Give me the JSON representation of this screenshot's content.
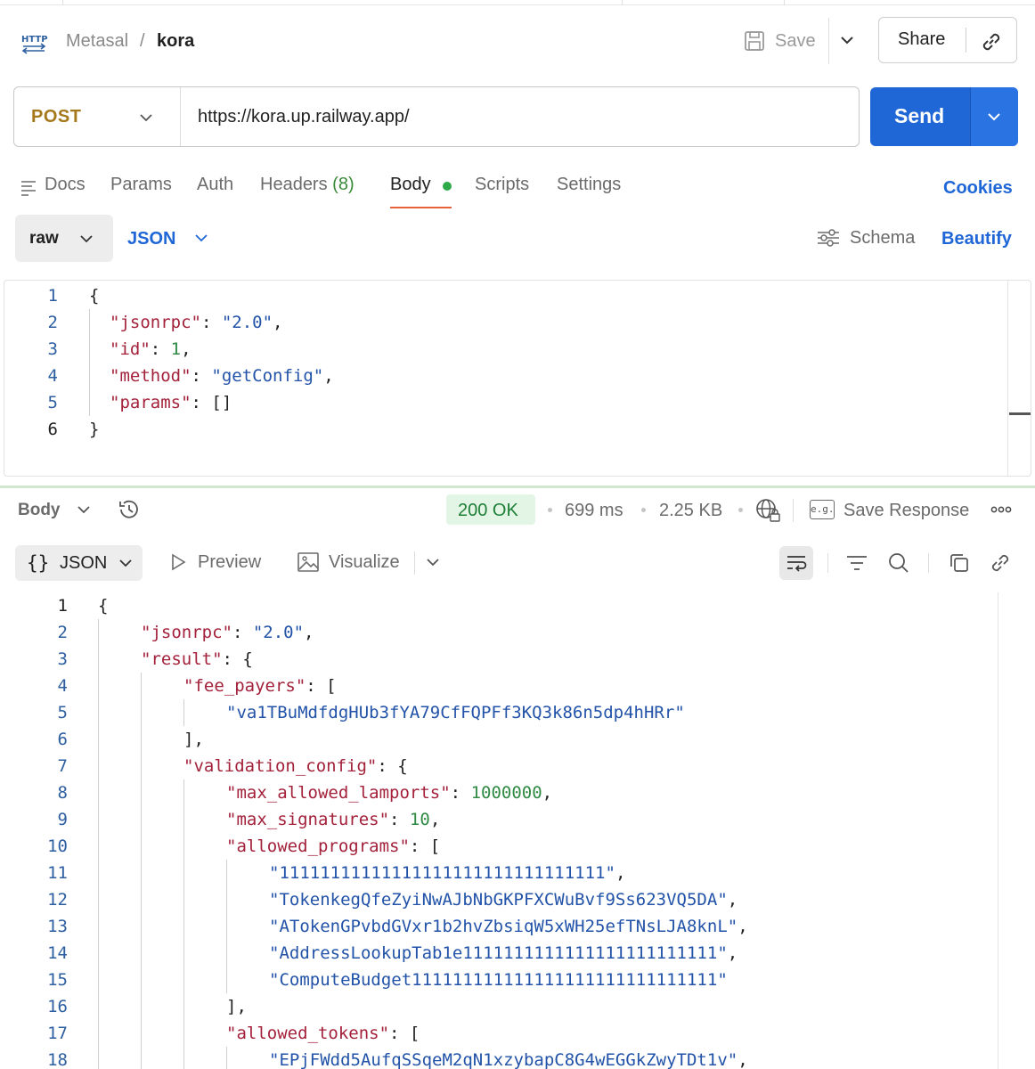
{
  "header": {
    "workspace": "Metasal",
    "separator": "/",
    "request_name": "kora",
    "save_label": "Save",
    "share_label": "Share"
  },
  "request": {
    "method": "POST",
    "url": "https://kora.up.railway.app/",
    "send_label": "Send"
  },
  "tabs": [
    {
      "label": "Docs"
    },
    {
      "label": "Params"
    },
    {
      "label": "Auth"
    },
    {
      "label": "Headers",
      "count": "(8)"
    },
    {
      "label": "Body",
      "active": true
    },
    {
      "label": "Scripts"
    },
    {
      "label": "Settings"
    }
  ],
  "cookies_label": "Cookies",
  "body_mode": {
    "raw_label": "raw",
    "format_label": "JSON",
    "schema_label": "Schema",
    "beautify_label": "Beautify"
  },
  "request_body_lines": [
    [
      [
        "p",
        "{"
      ]
    ],
    [
      [
        "k",
        "\"jsonrpc\""
      ],
      [
        "p",
        ": "
      ],
      [
        "s",
        "\"2.0\""
      ],
      [
        "p",
        ","
      ]
    ],
    [
      [
        "k",
        "\"id\""
      ],
      [
        "p",
        ": "
      ],
      [
        "n",
        "1"
      ],
      [
        "p",
        ","
      ]
    ],
    [
      [
        "k",
        "\"method\""
      ],
      [
        "p",
        ": "
      ],
      [
        "s",
        "\"getConfig\""
      ],
      [
        "p",
        ","
      ]
    ],
    [
      [
        "k",
        "\"params\""
      ],
      [
        "p",
        ": []"
      ]
    ],
    [
      [
        "p",
        "}"
      ]
    ]
  ],
  "request_body_indent": [
    0,
    1,
    1,
    1,
    1,
    0
  ],
  "response": {
    "body_label": "Body",
    "status": "200 OK",
    "time": "699 ms",
    "size": "2.25 KB",
    "save_response_label": "Save Response",
    "format_label": "JSON",
    "preview_label": "Preview",
    "visualize_label": "Visualize"
  },
  "response_body_lines": [
    [
      [
        "p",
        "{"
      ]
    ],
    [
      [
        "k",
        "\"jsonrpc\""
      ],
      [
        "p",
        ": "
      ],
      [
        "s",
        "\"2.0\""
      ],
      [
        "p",
        ","
      ]
    ],
    [
      [
        "k",
        "\"result\""
      ],
      [
        "p",
        ": {"
      ]
    ],
    [
      [
        "k",
        "\"fee_payers\""
      ],
      [
        "p",
        ": ["
      ]
    ],
    [
      [
        "s",
        "\"va1TBuMdfdgHUb3fYA79CfFQPFf3KQ3k86n5dp4hHRr\""
      ]
    ],
    [
      [
        "p",
        "],"
      ]
    ],
    [
      [
        "k",
        "\"validation_config\""
      ],
      [
        "p",
        ": {"
      ]
    ],
    [
      [
        "k",
        "\"max_allowed_lamports\""
      ],
      [
        "p",
        ": "
      ],
      [
        "n",
        "1000000"
      ],
      [
        "p",
        ","
      ]
    ],
    [
      [
        "k",
        "\"max_signatures\""
      ],
      [
        "p",
        ": "
      ],
      [
        "n",
        "10"
      ],
      [
        "p",
        ","
      ]
    ],
    [
      [
        "k",
        "\"allowed_programs\""
      ],
      [
        "p",
        ": ["
      ]
    ],
    [
      [
        "s",
        "\"11111111111111111111111111111111\""
      ],
      [
        "p",
        ","
      ]
    ],
    [
      [
        "s",
        "\"TokenkegQfeZyiNwAJbNbGKPFXCWuBvf9Ss623VQ5DA\""
      ],
      [
        "p",
        ","
      ]
    ],
    [
      [
        "s",
        "\"ATokenGPvbdGVxr1b2hvZbsiqW5xWH25efTNsLJA8knL\""
      ],
      [
        "p",
        ","
      ]
    ],
    [
      [
        "s",
        "\"AddressLookupTab1e1111111111111111111111111\""
      ],
      [
        "p",
        ","
      ]
    ],
    [
      [
        "s",
        "\"ComputeBudget111111111111111111111111111111\""
      ]
    ],
    [
      [
        "p",
        "],"
      ]
    ],
    [
      [
        "k",
        "\"allowed_tokens\""
      ],
      [
        "p",
        ": ["
      ]
    ],
    [
      [
        "s",
        "\"EPjFWdd5AufqSSqeM2qN1xzybapC8G4wEGGkZwyTDt1v\""
      ],
      [
        "p",
        ","
      ]
    ]
  ],
  "response_body_indent": [
    0,
    1,
    1,
    2,
    3,
    2,
    2,
    3,
    3,
    3,
    4,
    4,
    4,
    4,
    4,
    3,
    3,
    4
  ]
}
